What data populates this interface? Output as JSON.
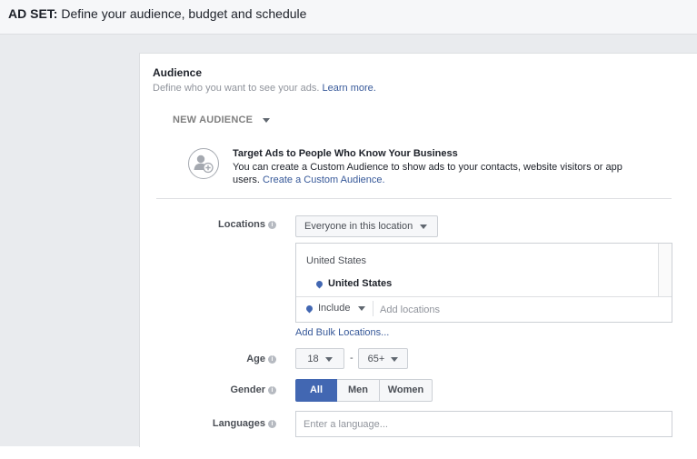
{
  "header": {
    "prefix": "AD SET:",
    "title": "Define your audience, budget and schedule"
  },
  "audience": {
    "heading": "Audience",
    "subtitle": "Define who you want to see your ads.",
    "learn_more": "Learn more.",
    "new_audience": "NEW AUDIENCE",
    "custom": {
      "icon": "custom-audience-icon",
      "title": "Target Ads to People Who Know Your Business",
      "desc": "You can create a Custom Audience to show ads to your contacts, website visitors or app users.",
      "link": "Create a Custom Audience."
    },
    "locations": {
      "label": "Locations",
      "mode": "Everyone in this location",
      "country": "United States",
      "selected": "United States",
      "include": "Include",
      "add_placeholder": "Add locations",
      "bulk": "Add Bulk Locations..."
    },
    "age": {
      "label": "Age",
      "min": "18",
      "dash": "-",
      "max": "65+"
    },
    "gender": {
      "label": "Gender",
      "options": [
        "All",
        "Men",
        "Women"
      ],
      "selected": "All"
    },
    "languages": {
      "label": "Languages",
      "placeholder": "Enter a language..."
    }
  },
  "colors": {
    "accent": "#4267b2",
    "link": "#365899",
    "canvas": "#e9ebee"
  }
}
